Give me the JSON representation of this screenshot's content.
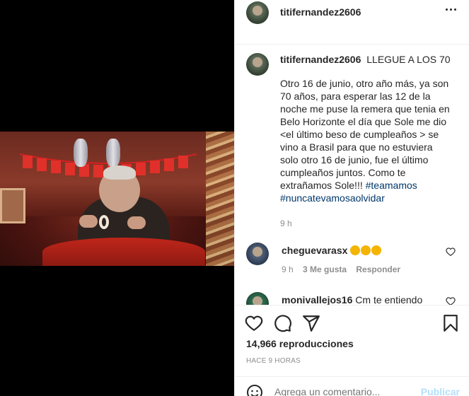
{
  "post": {
    "username": "titifernandez2606",
    "caption_title": "LLEGUE A LOS 70",
    "caption_text": "Otro 16 de junio, otro año más, ya son 70 años, para esperar las 12 de la noche me puse la remera que tenia en Belo Horizonte el día que Sole me dio <el último beso de cumpleaños > se vino a Brasil para que no estuviera solo otro 16 de junio, fue el último cumpleaños juntos. Como te extrañamos Sole!!! ",
    "hashtag1": "#teamamos",
    "hashtag2": "#nuncatevamosaolvidar",
    "caption_time": "9 h",
    "views": "14,966 reproducciones",
    "posted_ago": "HACE 9 HORAS"
  },
  "comments": [
    {
      "username": "cheguevarasx",
      "text": "",
      "emoji_count": 3,
      "time": "9 h",
      "likes": "3 Me gusta",
      "reply": "Responder"
    },
    {
      "username": "monivallejos16",
      "text": "Cm te entiendo"
    }
  ],
  "add_comment": {
    "placeholder": "Agrega un comentario...",
    "publish_label": "Publicar"
  },
  "colors": {
    "accent_link": "#00376b",
    "publish_disabled": "#b2dffc",
    "muted": "#8e8e8e"
  },
  "icons": [
    "more-options-icon",
    "heart-icon",
    "comment-icon",
    "share-icon",
    "bookmark-icon",
    "emoji-icon"
  ]
}
